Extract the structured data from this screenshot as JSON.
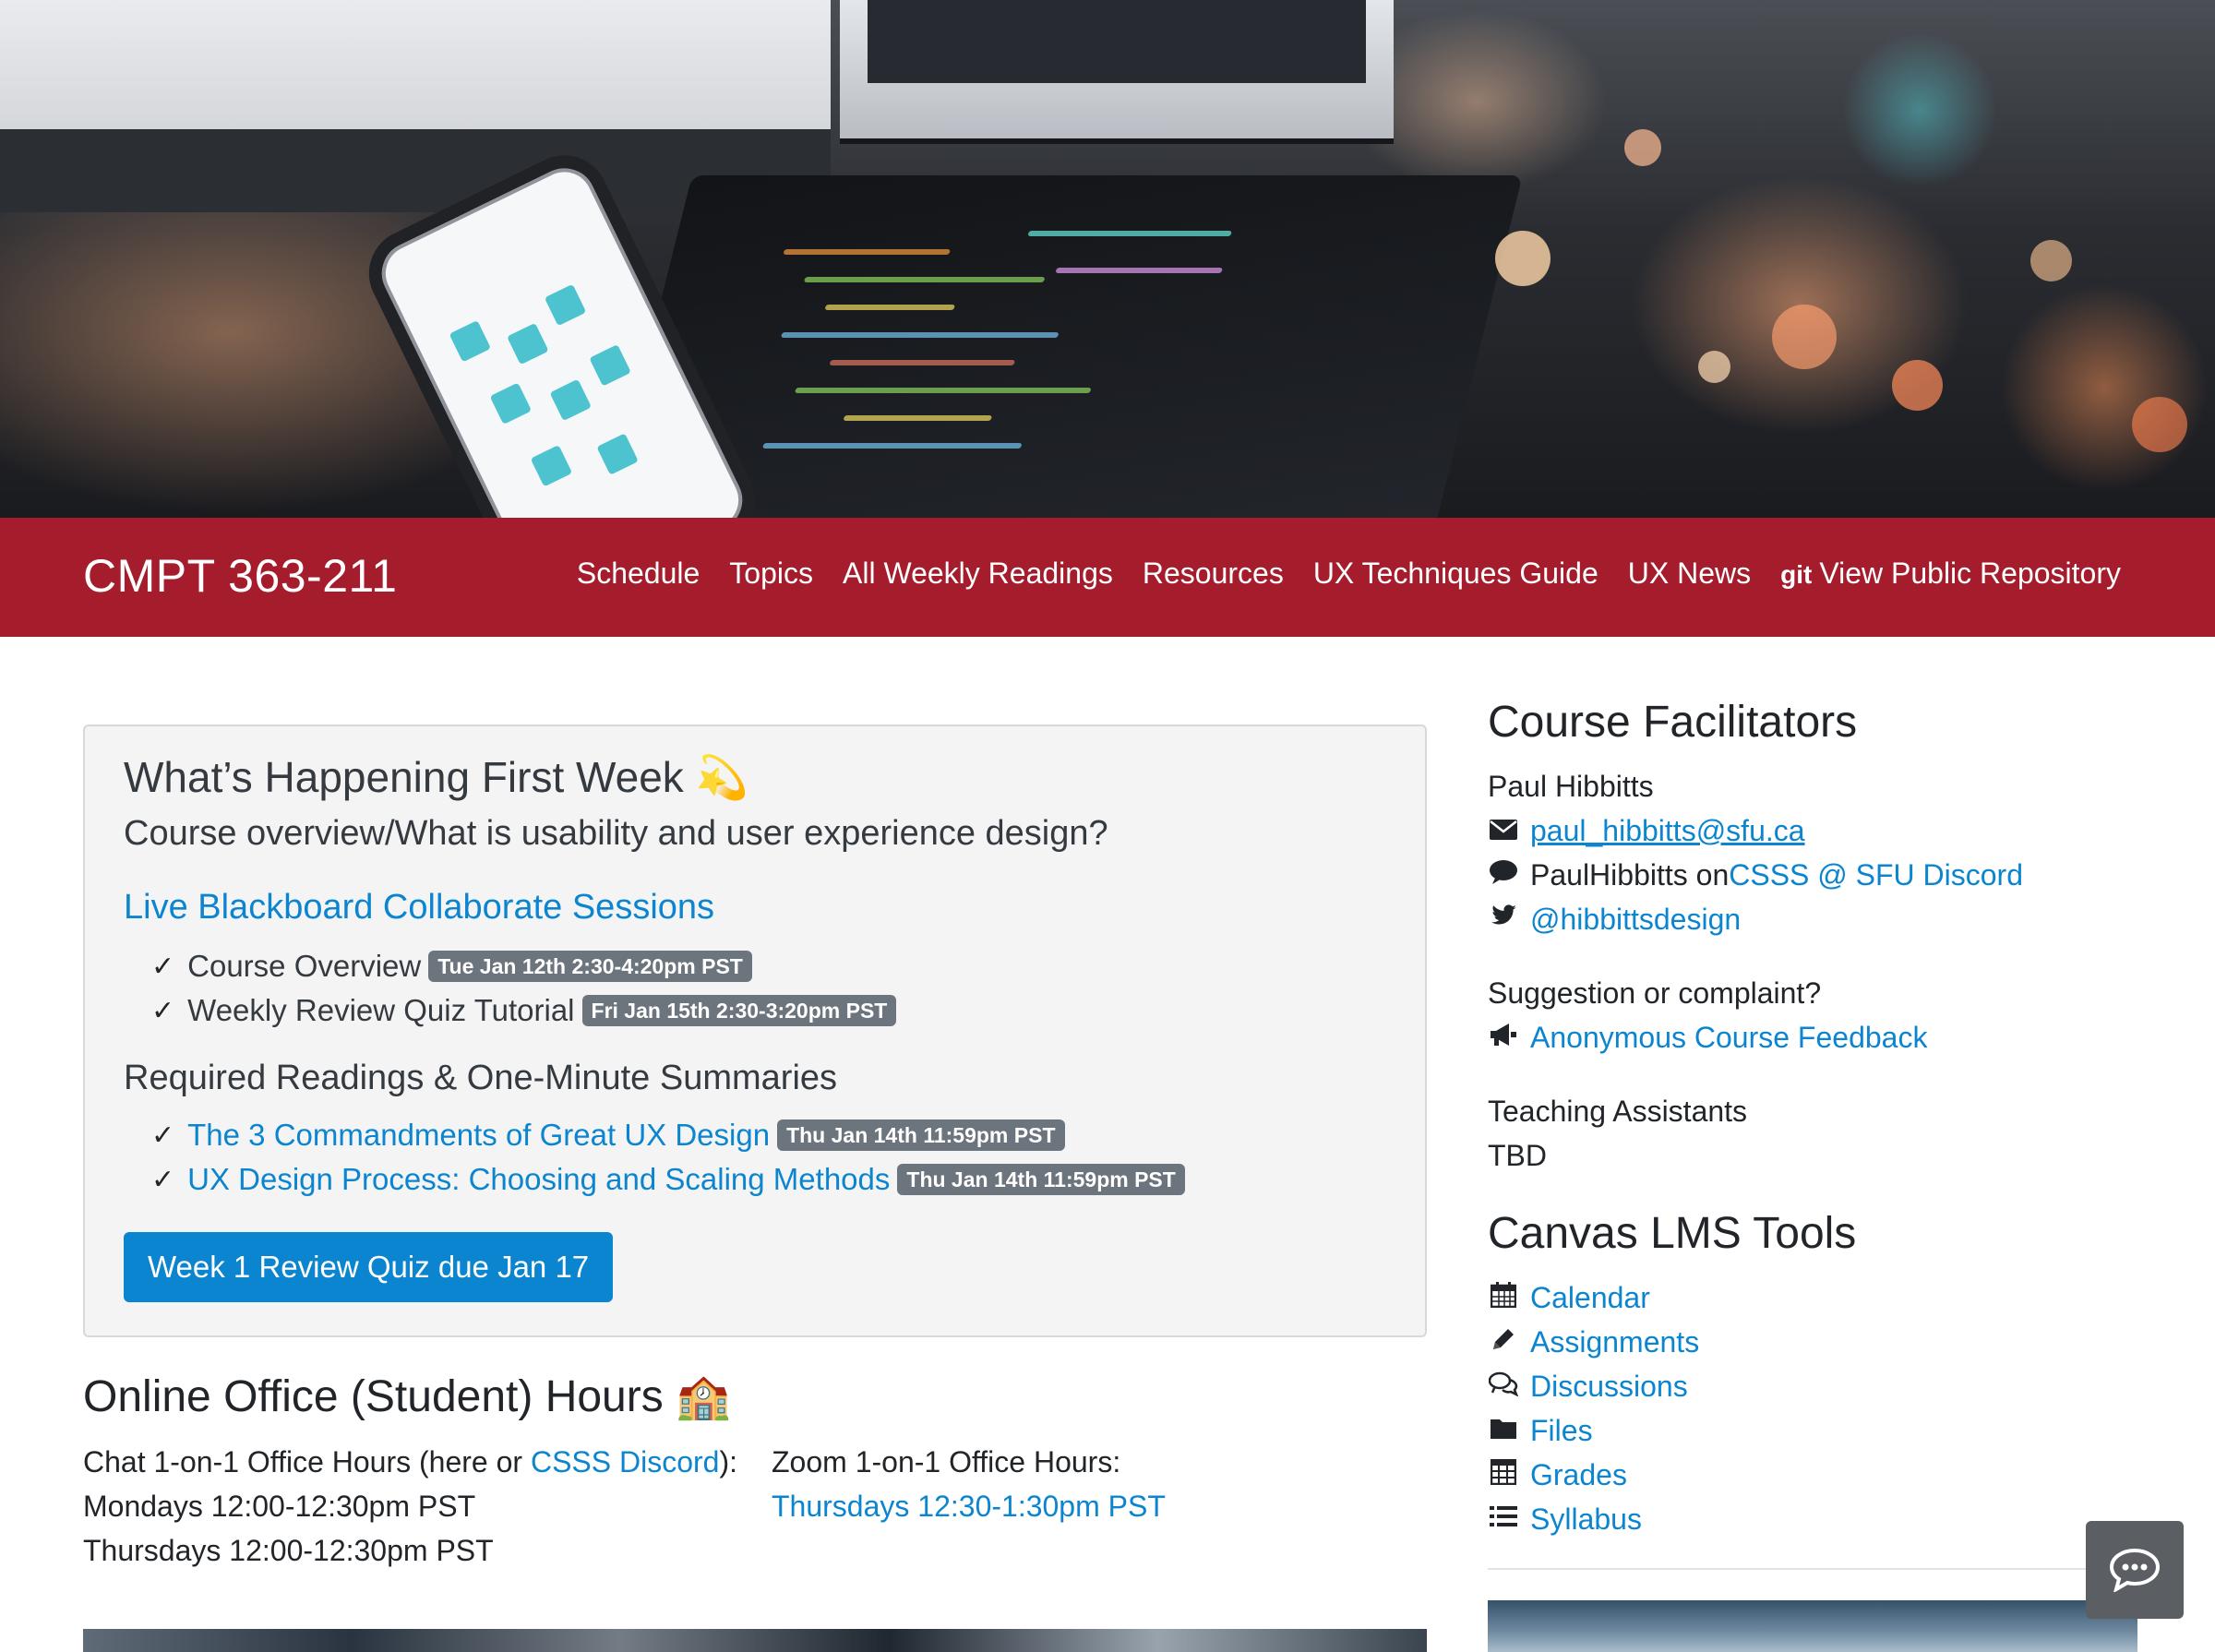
{
  "navbar": {
    "brand": "CMPT 363-211",
    "items": [
      {
        "label": "Schedule"
      },
      {
        "label": "Topics"
      },
      {
        "label": "All Weekly Readings"
      },
      {
        "label": "Resources"
      },
      {
        "label": "UX Techniques Guide"
      },
      {
        "label": "UX News"
      },
      {
        "label": "View Public Repository",
        "icon_text": "git"
      }
    ]
  },
  "first_week": {
    "title": "What’s Happening First Week 💫",
    "subtitle": "Course overview/What is usability and user experience design?",
    "sessions_link": "Live Blackboard Collaborate Sessions",
    "check_glyph": "✓",
    "sessions": [
      {
        "label": "Course Overview",
        "badge": "Tue Jan 12th 2:30-4:20pm PST"
      },
      {
        "label": "Weekly Review Quiz Tutorial",
        "badge": "Fri Jan 15th 2:30-3:20pm PST"
      }
    ],
    "readings_heading": "Required Readings & One-Minute Summaries",
    "readings": [
      {
        "label": "The 3 Commandments of Great UX Design",
        "badge": "Thu Jan 14th 11:59pm PST"
      },
      {
        "label": "UX Design Process: Choosing and Scaling Methods",
        "badge": "Thu Jan 14th 11:59pm PST"
      }
    ],
    "quiz_button": "Week 1 Review Quiz due Jan 17"
  },
  "office_hours": {
    "heading": "Online Office (Student) Hours 🏫",
    "chat_prefix": "Chat 1-on-1 Office Hours (here or ",
    "chat_link": "CSSS Discord",
    "chat_suffix": "):",
    "chat_times": [
      "Mondays 12:00-12:30pm PST",
      "Thursdays 12:00-12:30pm PST"
    ],
    "zoom_label": "Zoom 1-on-1 Office Hours:",
    "zoom_link": "Thursdays 12:30-1:30pm PST"
  },
  "facilitators": {
    "heading": "Course Facilitators",
    "name": "Paul Hibbitts",
    "email": "paul_hibbitts@sfu.ca",
    "discord_prefix": "PaulHibbitts on ",
    "discord_link": "CSSS @ SFU Discord",
    "twitter": "@hibbittsdesign",
    "suggestion_label": "Suggestion or complaint?",
    "feedback_link": "Anonymous Course Feedback",
    "ta_label": "Teaching Assistants",
    "ta_value": "TBD"
  },
  "canvas_tools": {
    "heading": "Canvas LMS Tools",
    "items": [
      {
        "label": "Calendar",
        "icon": "calendar-icon"
      },
      {
        "label": "Assignments",
        "icon": "pencil-icon"
      },
      {
        "label": "Discussions",
        "icon": "comments-icon"
      },
      {
        "label": "Files",
        "icon": "folder-icon"
      },
      {
        "label": "Grades",
        "icon": "table-icon"
      },
      {
        "label": "Syllabus",
        "icon": "list-icon"
      }
    ]
  },
  "colors": {
    "navbar": "#a51d2d",
    "link": "#0c85d0",
    "badge": "#6c757d",
    "panel_bg": "#f4f4f4"
  }
}
